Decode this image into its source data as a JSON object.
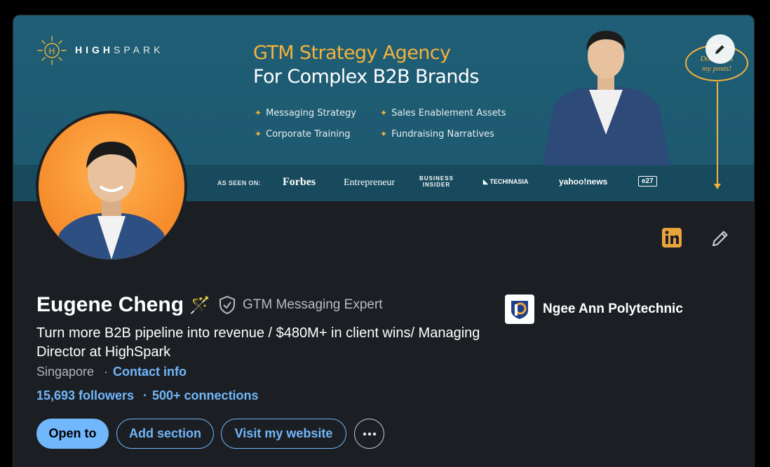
{
  "banner": {
    "brand_prefix": "HIGH",
    "brand_suffix": "SPARK",
    "tagline_line1": "GTM Strategy Agency",
    "tagline_line2": "For Complex B2B Brands",
    "services": [
      "Messaging Strategy",
      "Sales Enablement Assets",
      "Corporate Training",
      "Fundraising Narratives"
    ],
    "as_seen_on_label": "AS SEEN ON:",
    "press": {
      "forbes": "Forbes",
      "entrepreneur": "Entrepreneur",
      "business_insider_line1": "BUSINESS",
      "business_insider_line2": "INSIDER",
      "techinasia": "TECHINASIA",
      "yahoo": "yahoo!news",
      "e27": "e27"
    },
    "callout": "Don't miss my posts!",
    "accent_color": "#f6b23a"
  },
  "profile": {
    "name": "Eugene Cheng",
    "name_emoji": "🪄",
    "badge_text": "GTM Messaging Expert",
    "headline": "Turn more B2B pipeline into revenue / $480M+ in client wins/ Managing Director at HighSpark",
    "location": "Singapore",
    "separator": "·",
    "contact_info": "Contact info",
    "followers": "15,693 followers",
    "connections": "500+ connections"
  },
  "education": {
    "name": "Ngee Ann Polytechnic"
  },
  "actions": {
    "open_to": "Open to",
    "add_section": "Add section",
    "visit_website": "Visit my website",
    "more": "more-options"
  },
  "icons": {
    "linkedin": "linkedin-icon",
    "edit": "pencil-icon",
    "verified": "shield-check-icon"
  },
  "colors": {
    "link": "#71b7fb",
    "card_bg": "#1b1f23",
    "banner_bg": "#1f5e76"
  }
}
